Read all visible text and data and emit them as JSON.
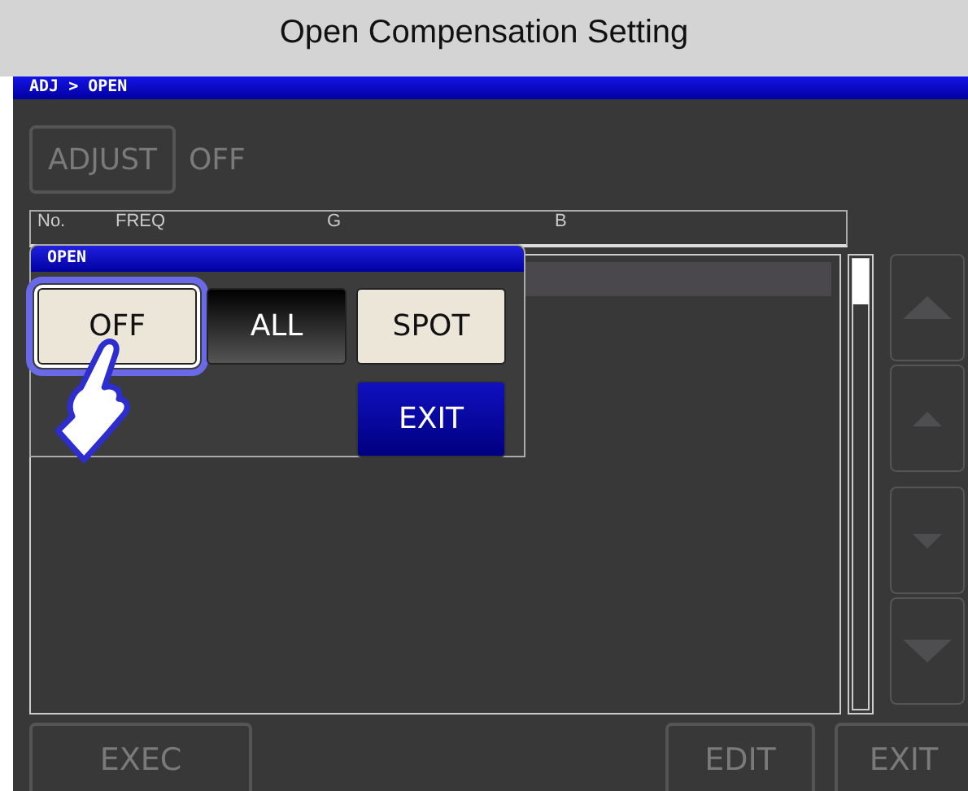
{
  "title": "Open Compensation Setting",
  "breadcrumb": "ADJ > OPEN",
  "adjust": {
    "label": "ADJUST",
    "disabled": true,
    "value": "OFF"
  },
  "table": {
    "columns": [
      "No.",
      "FREQ",
      "G",
      "B"
    ]
  },
  "side_buttons": [
    {
      "kind": "page_up",
      "disabled": true
    },
    {
      "kind": "line_up",
      "disabled": true
    },
    {
      "kind": "line_down",
      "disabled": true
    },
    {
      "kind": "page_down",
      "disabled": true
    }
  ],
  "bottom_buttons": [
    {
      "label": "EXEC",
      "disabled": true
    },
    {
      "label": "EDIT",
      "disabled": true
    },
    {
      "label": "EXIT",
      "disabled": true
    }
  ],
  "popup": {
    "title": "OPEN",
    "options": [
      {
        "label": "OFF",
        "kind": "option",
        "selected": true,
        "active": false
      },
      {
        "label": "ALL",
        "kind": "option",
        "selected": false,
        "active": true
      },
      {
        "label": "SPOT",
        "kind": "option",
        "selected": false,
        "active": false
      },
      {
        "label": "EXIT",
        "kind": "exit",
        "selected": false
      }
    ]
  }
}
